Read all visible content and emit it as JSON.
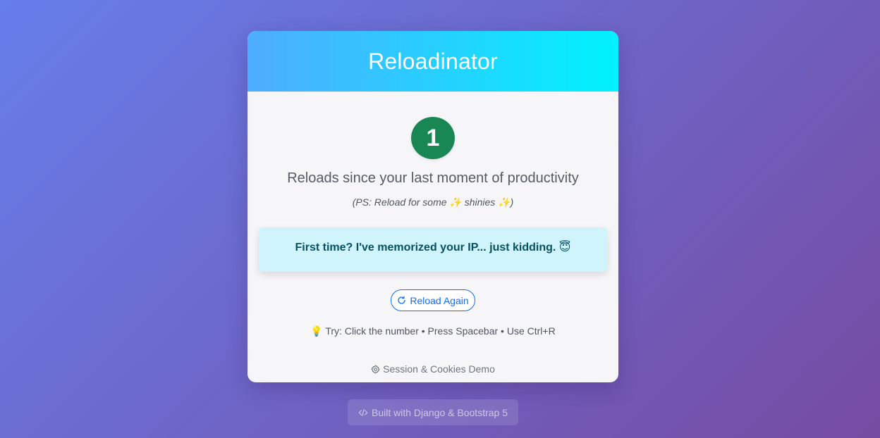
{
  "app": {
    "title": "Reloadinator"
  },
  "counter": {
    "value": "1",
    "color": "#198754"
  },
  "main": {
    "subtitle": "Reloads since your last moment of productivity",
    "ps_note": "(PS: Reload for some ✨ shinies ✨)"
  },
  "alert": {
    "message": "First time? I've memorized your IP... just kidding. 😇"
  },
  "actions": {
    "reload_label": "Reload Again",
    "reload_icon": "arrow-clockwise-icon"
  },
  "tip": {
    "text": "💡 Try: Click the number • Press Spacebar • Use Ctrl+R"
  },
  "footer": {
    "demo_link_label": "Session & Cookies Demo",
    "demo_link_icon": "gear-icon",
    "built_with": "Built with Django & Bootstrap 5",
    "built_icon": "code-slash-icon"
  },
  "colors": {
    "header_gradient_start": "#4facfe",
    "header_gradient_end": "#00f2fe",
    "background_start": "#667eea",
    "background_end": "#764ba2",
    "alert_background": "#cff4fc",
    "alert_text": "#055160",
    "primary": "#0d6efd"
  }
}
